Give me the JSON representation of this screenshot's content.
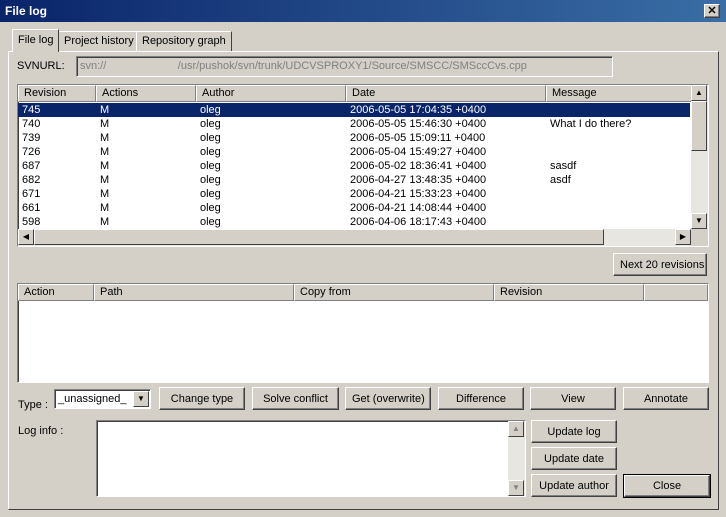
{
  "window": {
    "title": "File log",
    "close_glyph": "✕"
  },
  "tabs": [
    {
      "label": "File log",
      "active": true
    },
    {
      "label": "Project history",
      "active": false
    },
    {
      "label": "Repository graph",
      "active": false
    }
  ],
  "svnurl": {
    "label": "SVNURL:",
    "value": "svn://             /usr/pushok/svn/trunk/UDCVSPROXY1/Source/SMSCC/SMSccCvs.cpp"
  },
  "revisions_table": {
    "columns": [
      "Revision",
      "Actions",
      "Author",
      "Date",
      "Message"
    ],
    "rows": [
      {
        "revision": "745",
        "action": "M",
        "author": "oleg",
        "date": "2006-05-05 17:04:35 +0400",
        "message": "",
        "selected": true
      },
      {
        "revision": "740",
        "action": "M",
        "author": "oleg",
        "date": "2006-05-05 15:46:30 +0400",
        "message": "What I do there?"
      },
      {
        "revision": "739",
        "action": "M",
        "author": "oleg",
        "date": "2006-05-05 15:09:11 +0400",
        "message": ""
      },
      {
        "revision": "726",
        "action": "M",
        "author": "oleg",
        "date": "2006-05-04 15:49:27 +0400",
        "message": ""
      },
      {
        "revision": "687",
        "action": "M",
        "author": "oleg",
        "date": "2006-05-02 18:36:41 +0400",
        "message": "sasdf"
      },
      {
        "revision": "682",
        "action": "M",
        "author": "oleg",
        "date": "2006-04-27 13:48:35 +0400",
        "message": "asdf"
      },
      {
        "revision": "671",
        "action": "M",
        "author": "oleg",
        "date": "2006-04-21 15:33:23 +0400",
        "message": ""
      },
      {
        "revision": "661",
        "action": "M",
        "author": "oleg",
        "date": "2006-04-21 14:08:44 +0400",
        "message": ""
      },
      {
        "revision": "598",
        "action": "M",
        "author": "oleg",
        "date": "2006-04-06 18:17:43 +0400",
        "message": ""
      }
    ]
  },
  "next_revisions_label": "Next 20 revisions",
  "paths_table": {
    "columns": [
      "Action",
      "Path",
      "Copy from",
      "Revision"
    ]
  },
  "type": {
    "label": "Type :",
    "value": "_unassigned_"
  },
  "actions": {
    "change_type": "Change type",
    "solve_conflict": "Solve conflict",
    "get_overwrite": "Get (overwrite)",
    "difference": "Difference",
    "view": "View",
    "annotate": "Annotate"
  },
  "log_info": {
    "label": "Log info :",
    "value": ""
  },
  "side_buttons": {
    "update_log": "Update log",
    "update_date": "Update date",
    "update_author": "Update author",
    "close": "Close"
  },
  "icons": {
    "arrow_up": "▲",
    "arrow_down": "▼",
    "arrow_left": "◀",
    "arrow_right": "▶"
  },
  "colors": {
    "title_bar": "#0a246a",
    "selection": "#0a246a",
    "face": "#d4d0c8"
  }
}
